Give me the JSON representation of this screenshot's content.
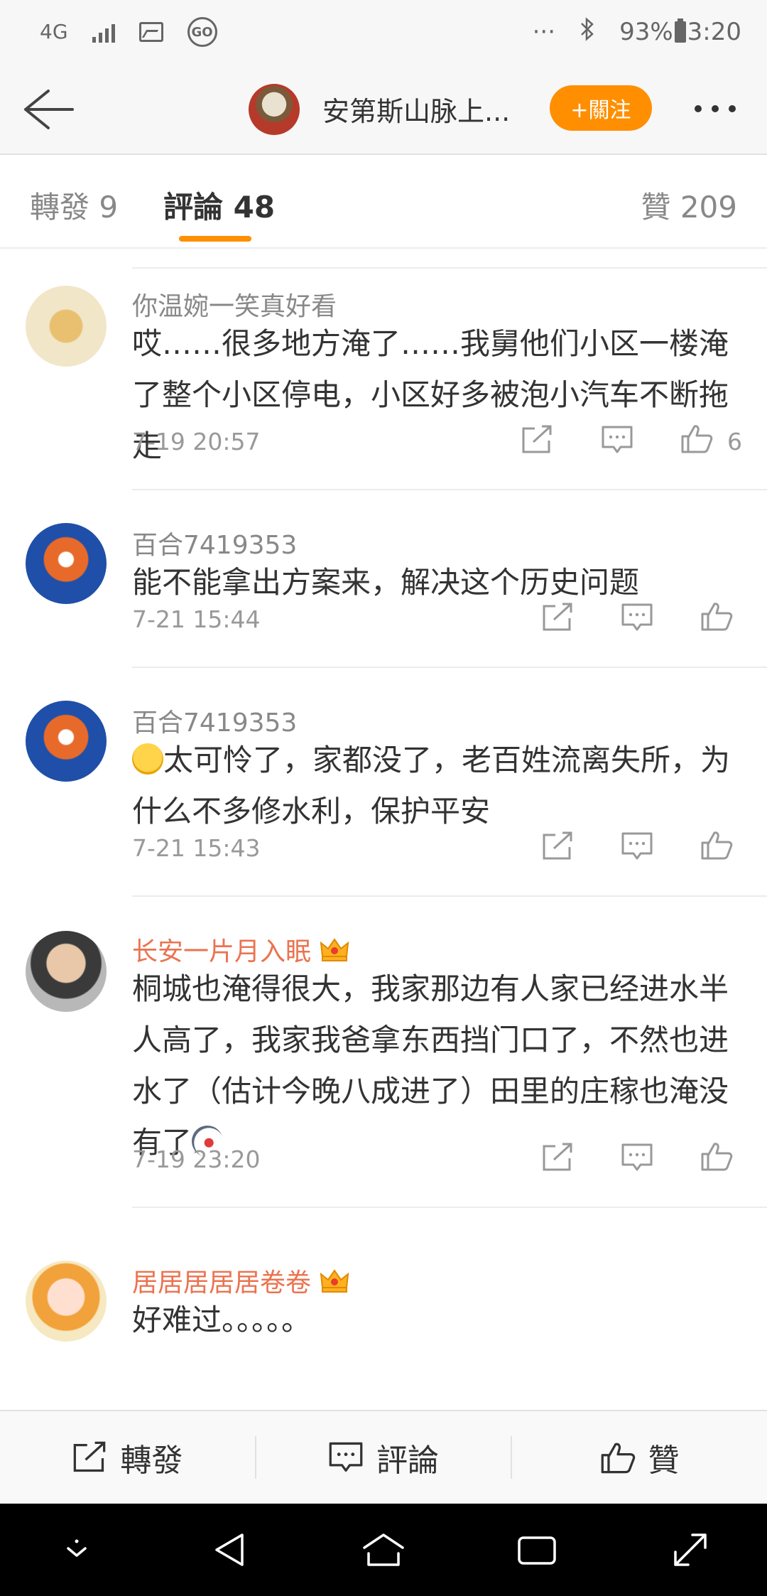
{
  "status_bar": {
    "network": "4G",
    "more": "···",
    "battery": "93%",
    "time": "3:20"
  },
  "nav": {
    "title": "安第斯山脉上...",
    "follow_label": "+關注"
  },
  "tabs": {
    "repost": "轉發 9",
    "comments": "評論 48",
    "likes": "贊 209"
  },
  "comments": [
    {
      "user": "你温婉一笑真好看",
      "text": "哎……很多地方淹了……我舅他们小区一楼淹了整个小区停电，小区好多被泡小汽车不断拖走",
      "time": "7-19 20:57",
      "likes": "6"
    },
    {
      "user": "百合7419353",
      "text": "能不能拿出方案来，解决这个历史问题",
      "time": "7-21 15:44",
      "likes": ""
    },
    {
      "user": "百合7419353",
      "text": "太可怜了，家都没了，老百姓流离失所，为什么不多修水利，保护平安",
      "time": "7-21 15:43",
      "likes": ""
    },
    {
      "user": "长安一片月入眠",
      "text": "桐城也淹得很大，我家那边有人家已经进水半人高了，我家我爸拿东西挡门口了，不然也进水了（估计今晚八成进了）田里的庄稼也淹没有了",
      "time": "7-19 23:20",
      "likes": ""
    },
    {
      "user": "居居居居居卷卷",
      "text": "好难过。。。。。",
      "time": "",
      "likes": ""
    }
  ],
  "bottom_bar": {
    "repost": "轉發",
    "comment": "評論",
    "like": "贊"
  },
  "colors": {
    "accent": "#ff8f00",
    "vip_name": "#eb7350",
    "muted": "#999999"
  }
}
